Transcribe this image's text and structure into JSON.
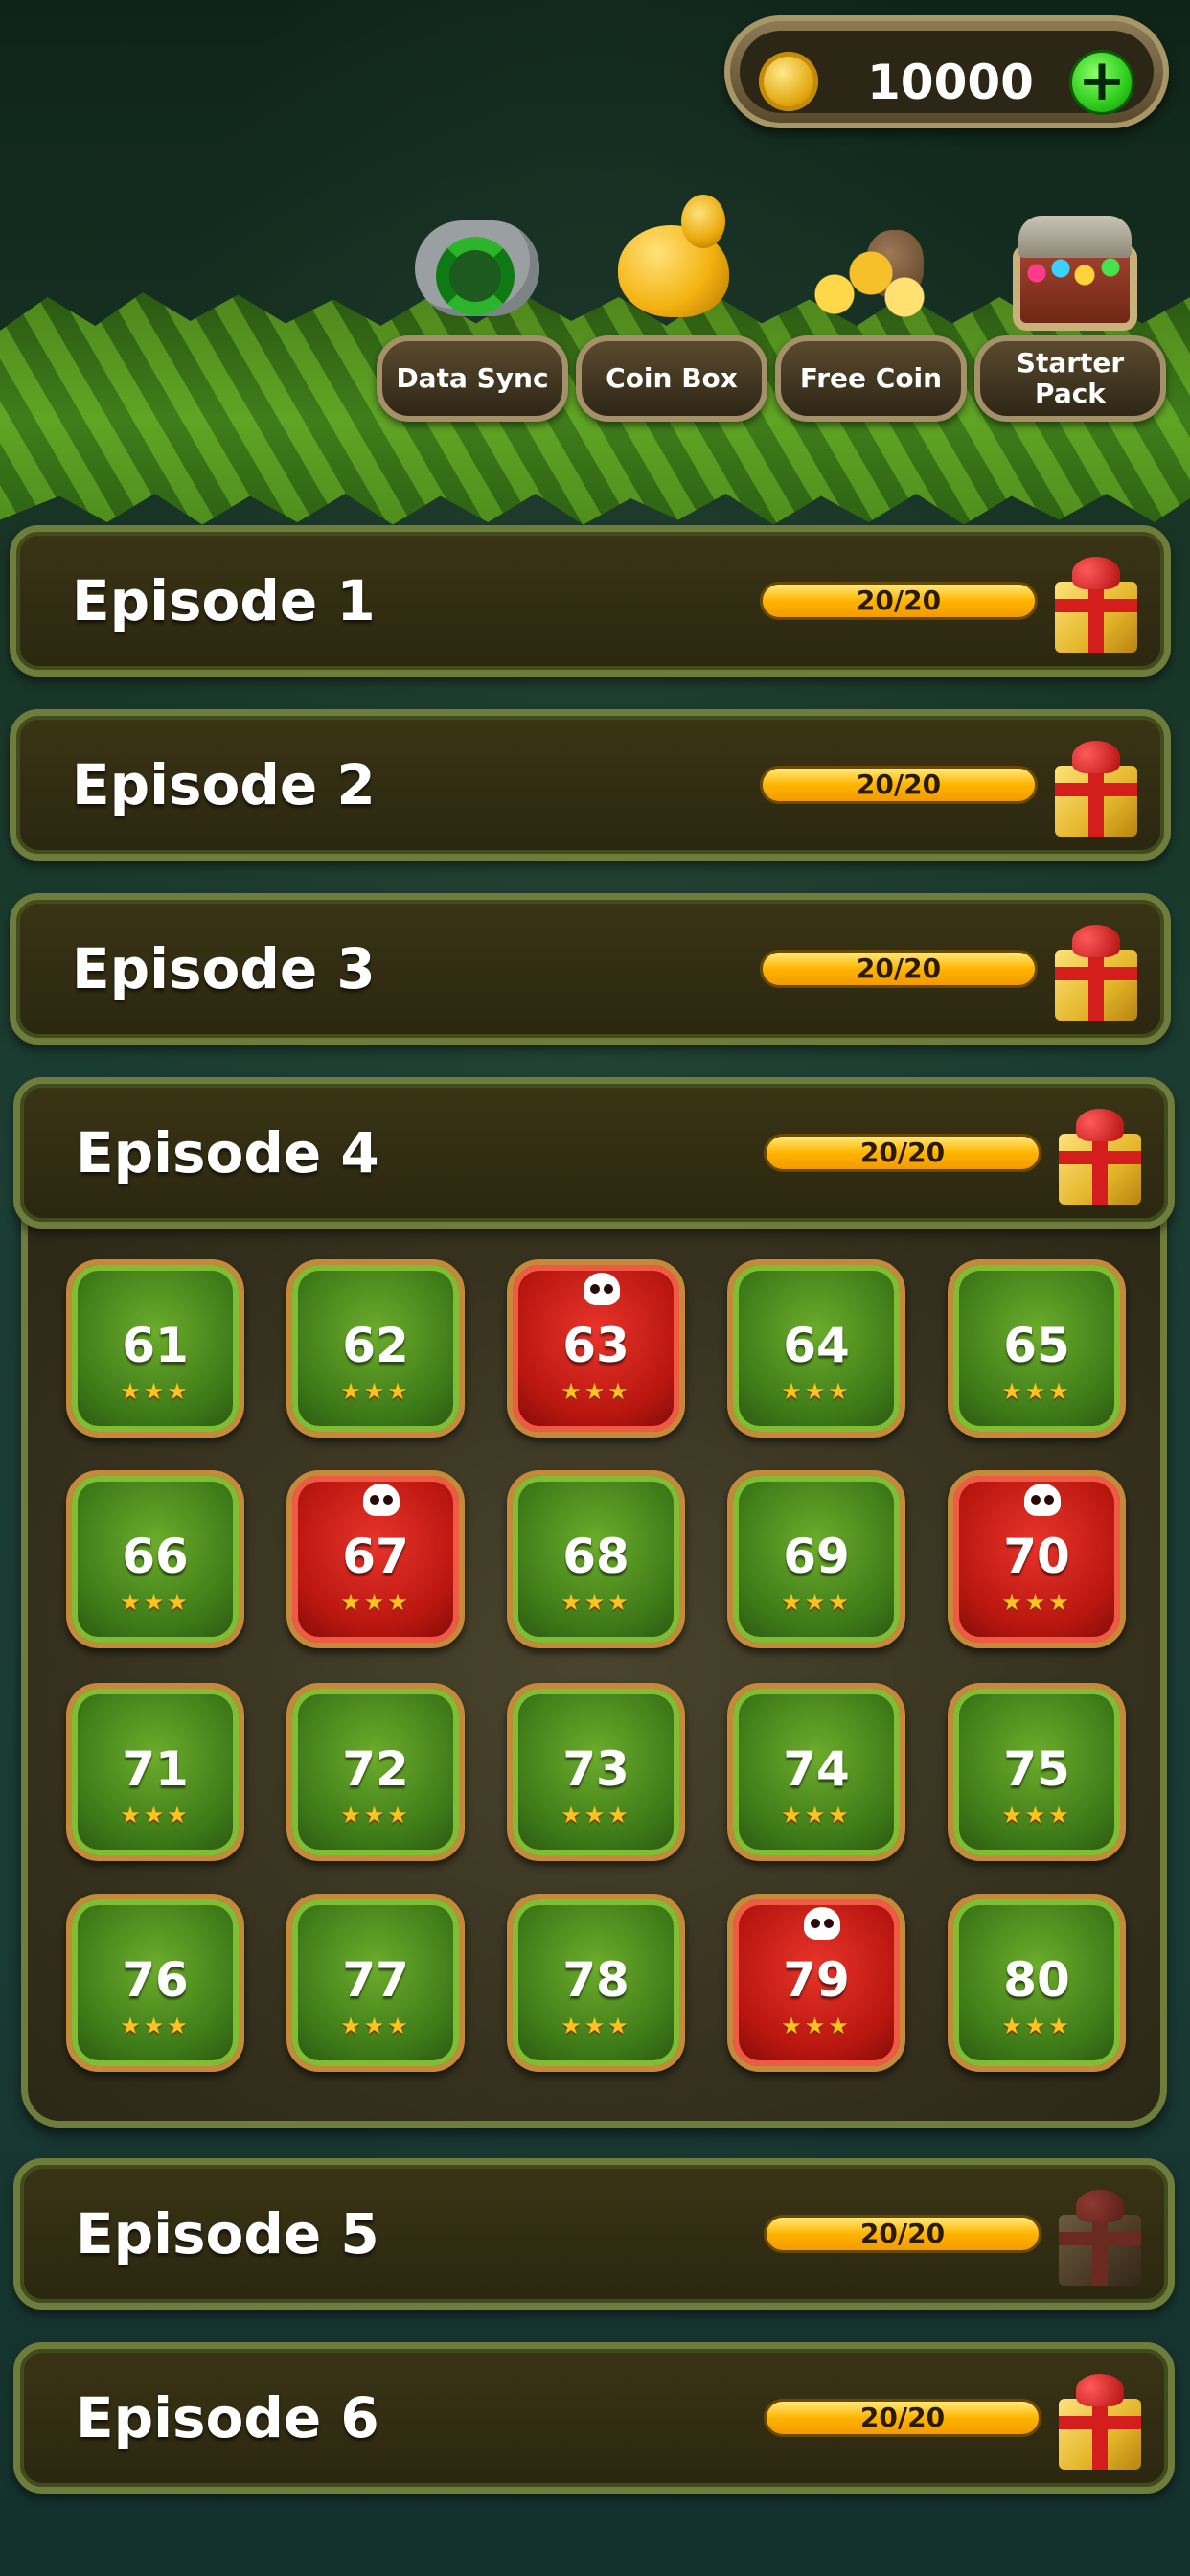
{
  "header": {
    "coins": "10000"
  },
  "shortcuts": [
    {
      "label": "Data Sync"
    },
    {
      "label": "Coin Box"
    },
    {
      "label": "Free Coin"
    },
    {
      "label": "Starter\nPack"
    }
  ],
  "episodes": [
    {
      "title": "Episode 1",
      "progress": "20/20"
    },
    {
      "title": "Episode 2",
      "progress": "20/20"
    },
    {
      "title": "Episode 3",
      "progress": "20/20"
    },
    {
      "title": "Episode 4",
      "progress": "20/20"
    },
    {
      "title": "Episode 5",
      "progress": "20/20"
    },
    {
      "title": "Episode 6",
      "progress": "20/20"
    }
  ],
  "levels": [
    {
      "number": "61",
      "stars": "★★★",
      "boss": false
    },
    {
      "number": "62",
      "stars": "★★★",
      "boss": false
    },
    {
      "number": "63",
      "stars": "★★★",
      "boss": true
    },
    {
      "number": "64",
      "stars": "★★★",
      "boss": false
    },
    {
      "number": "65",
      "stars": "★★★",
      "boss": false
    },
    {
      "number": "66",
      "stars": "★★★",
      "boss": false
    },
    {
      "number": "67",
      "stars": "★★★",
      "boss": true
    },
    {
      "number": "68",
      "stars": "★★★",
      "boss": false
    },
    {
      "number": "69",
      "stars": "★★★",
      "boss": false
    },
    {
      "number": "70",
      "stars": "★★★",
      "boss": true
    },
    {
      "number": "71",
      "stars": "★★★",
      "boss": false
    },
    {
      "number": "72",
      "stars": "★★★",
      "boss": false
    },
    {
      "number": "73",
      "stars": "★★★",
      "boss": false
    },
    {
      "number": "74",
      "stars": "★★★",
      "boss": false
    },
    {
      "number": "75",
      "stars": "★★★",
      "boss": false
    },
    {
      "number": "76",
      "stars": "★★★",
      "boss": false
    },
    {
      "number": "77",
      "stars": "★★★",
      "boss": false
    },
    {
      "number": "78",
      "stars": "★★★",
      "boss": false
    },
    {
      "number": "79",
      "stars": "★★★",
      "boss": true
    },
    {
      "number": "80",
      "stars": "★★★",
      "boss": false
    }
  ],
  "colors": {
    "level_green": "#3d7a18",
    "level_red": "#b8160f",
    "progress_gold": "#ffb400",
    "frame_moss": "#6e7d3b"
  }
}
